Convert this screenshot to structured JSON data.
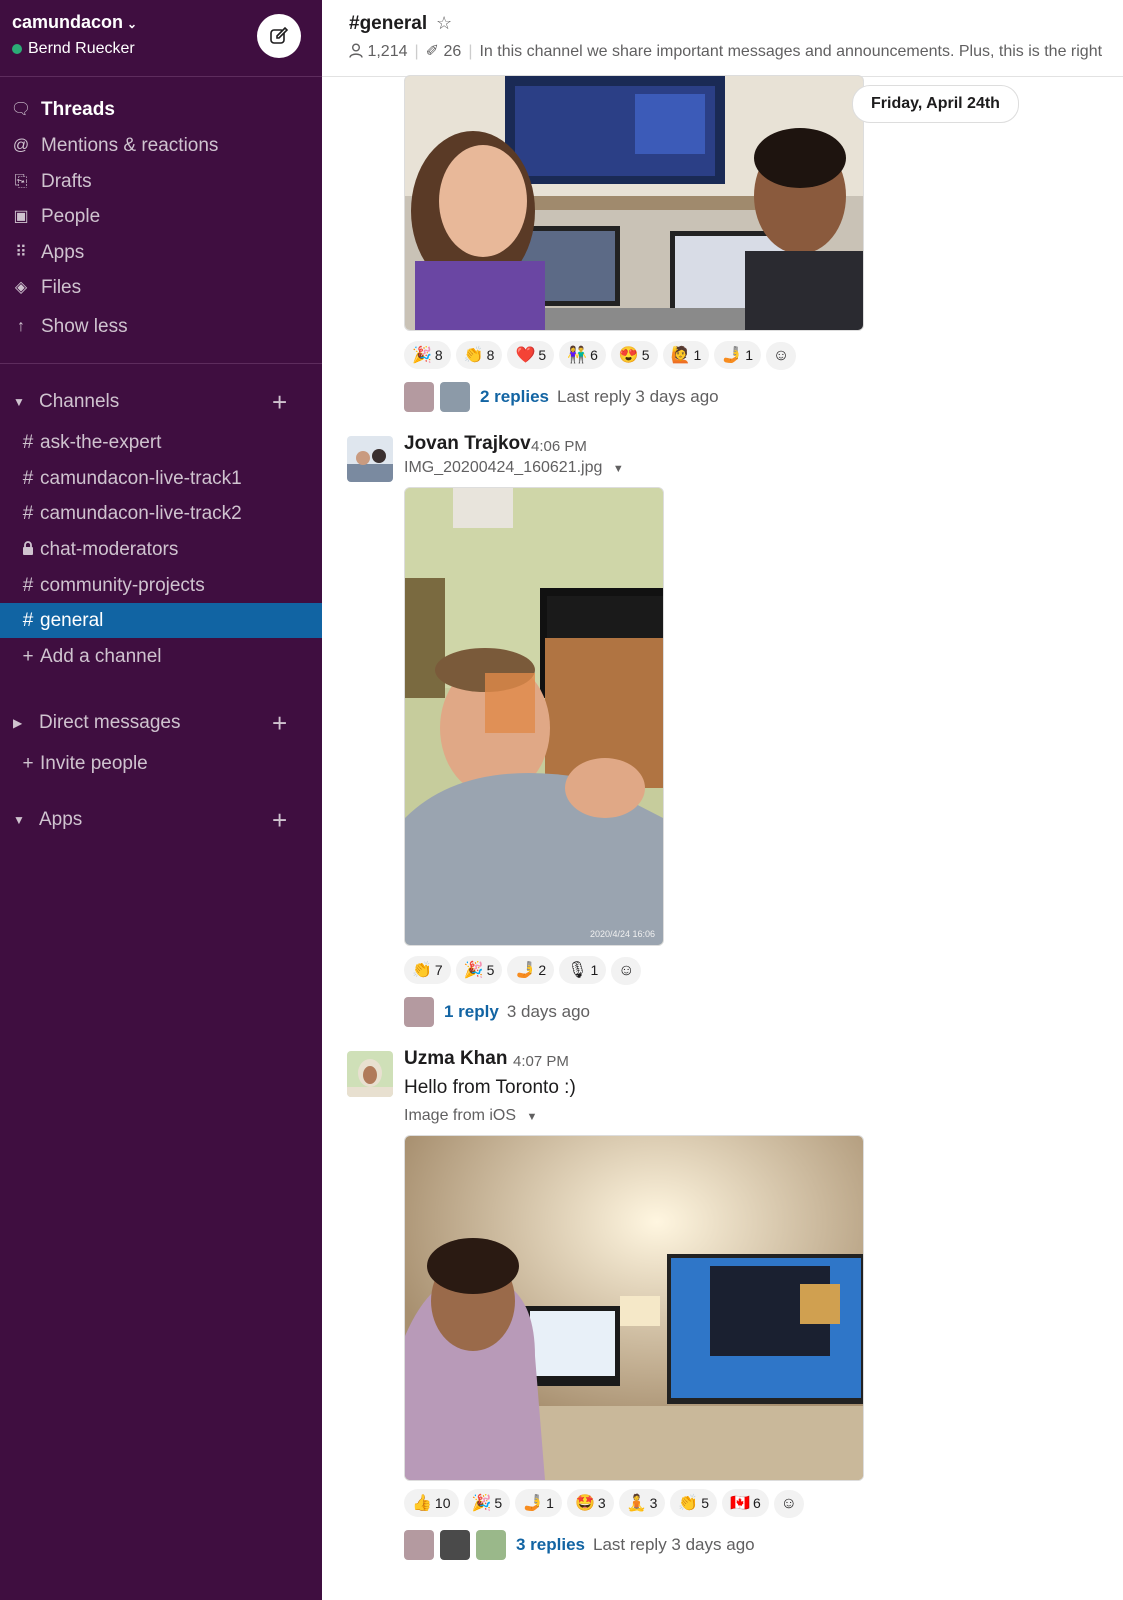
{
  "workspace": {
    "name": "camundacon",
    "user": "Bernd Ruecker"
  },
  "nav": [
    {
      "label": "Threads",
      "icon": "threads-icon"
    },
    {
      "label": "Mentions & reactions",
      "icon": "at-icon"
    },
    {
      "label": "Drafts",
      "icon": "drafts-icon"
    },
    {
      "label": "People",
      "icon": "people-icon"
    },
    {
      "label": "Apps",
      "icon": "apps-icon"
    },
    {
      "label": "Files",
      "icon": "files-icon"
    },
    {
      "label": "Show less",
      "icon": "arrow-up-icon"
    }
  ],
  "sections": {
    "channels": "Channels",
    "direct_messages": "Direct messages",
    "apps": "Apps",
    "add_channel": "Add a channel",
    "invite_people": "Invite people"
  },
  "channels": [
    {
      "name": "ask-the-expert",
      "private": false
    },
    {
      "name": "camundacon-live-track1",
      "private": false
    },
    {
      "name": "camundacon-live-track2",
      "private": false
    },
    {
      "name": "chat-moderators",
      "private": true
    },
    {
      "name": "community-projects",
      "private": false
    },
    {
      "name": "general",
      "private": false,
      "active": true
    }
  ],
  "header": {
    "title": "#general",
    "members": "1,214",
    "pins": "26",
    "topic": "In this channel we share important messages and announcements. Plus, this is the right"
  },
  "date_divider": "Friday, April 24th",
  "messages": [
    {
      "id": "m0",
      "reactions": [
        {
          "emoji": "🎉",
          "count": "8"
        },
        {
          "emoji": "👏",
          "count": "8"
        },
        {
          "emoji": "❤️",
          "count": "5"
        },
        {
          "emoji": "👫",
          "count": "6"
        },
        {
          "emoji": "😍",
          "count": "5"
        },
        {
          "emoji": "🙋",
          "count": "1"
        },
        {
          "emoji": "🤳",
          "count": "1"
        }
      ],
      "replies_label": "2 replies",
      "replies_time": "Last reply 3 days ago"
    },
    {
      "id": "m1",
      "sender": "Jovan Trajkov",
      "time": "4:06 PM",
      "file": "IMG_20200424_160621.jpg",
      "photo_stamp": "2020/4/24 16:06",
      "reactions": [
        {
          "emoji": "👏",
          "count": "7"
        },
        {
          "emoji": "🎉",
          "count": "5"
        },
        {
          "emoji": "🤳",
          "count": "2"
        },
        {
          "emoji": "🎙",
          "count": "1"
        }
      ],
      "replies_label": "1 reply",
      "replies_time": "3 days ago"
    },
    {
      "id": "m2",
      "sender": "Uzma Khan",
      "time": "4:07 PM",
      "text": "Hello from Toronto :)",
      "file": "Image from iOS",
      "reactions": [
        {
          "emoji": "👍",
          "count": "10"
        },
        {
          "emoji": "🎉",
          "count": "5"
        },
        {
          "emoji": "🤳",
          "count": "1"
        },
        {
          "emoji": "🤩",
          "count": "3"
        },
        {
          "emoji": "🧘",
          "count": "3"
        },
        {
          "emoji": "👏",
          "count": "5"
        },
        {
          "emoji": "🇨🇦",
          "count": "6"
        }
      ],
      "replies_label": "3 replies",
      "replies_time": "Last reply 3 days ago"
    }
  ],
  "colors": {
    "sidebar": "#3f0e40",
    "active": "#1164a3",
    "link": "#1264a3",
    "presence": "#2bac76"
  }
}
